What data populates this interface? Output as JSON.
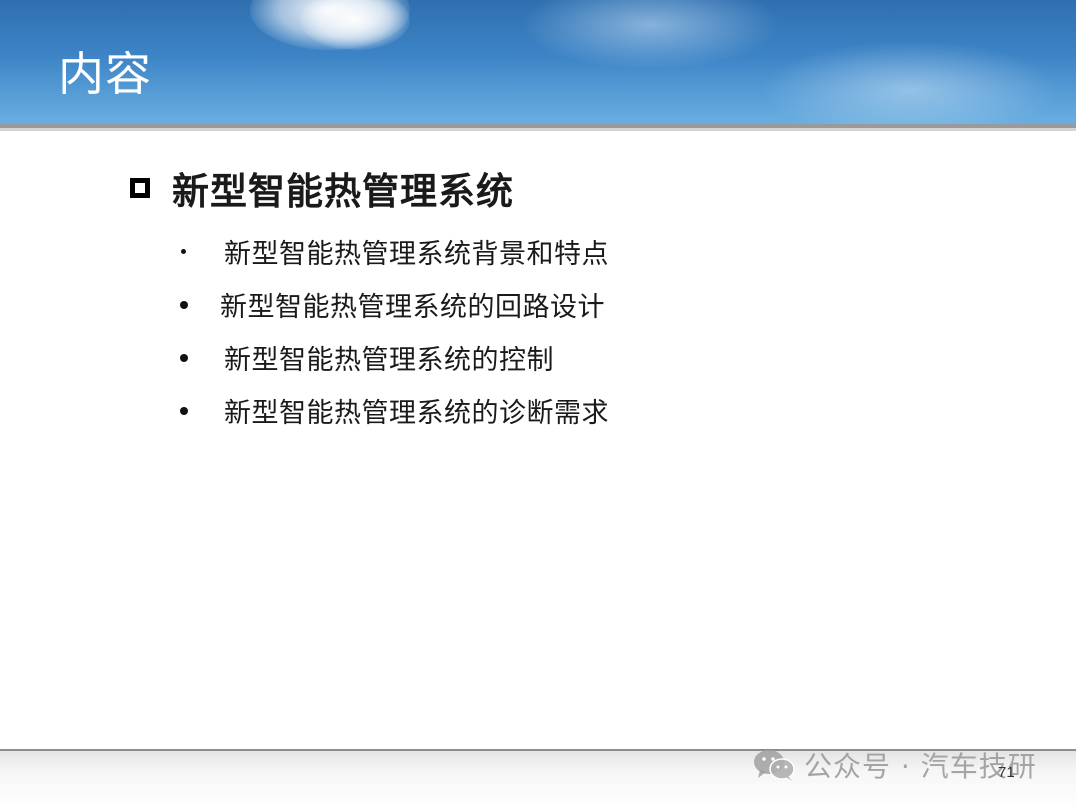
{
  "header": {
    "title": "内容"
  },
  "section": {
    "title": "新型智能热管理系统"
  },
  "bullets": [
    "新型智能热管理系统背景和特点",
    "新型智能热管理系统的回路设计",
    "新型智能热管理系统的控制",
    "新型智能热管理系统的诊断需求"
  ],
  "footer": {
    "watermark": "公众号 · 汽车技研",
    "page_number": "71"
  },
  "colors": {
    "header_blue": "#3d84c6",
    "title_text": "#ffffff",
    "body_text": "#1a1a1a"
  }
}
